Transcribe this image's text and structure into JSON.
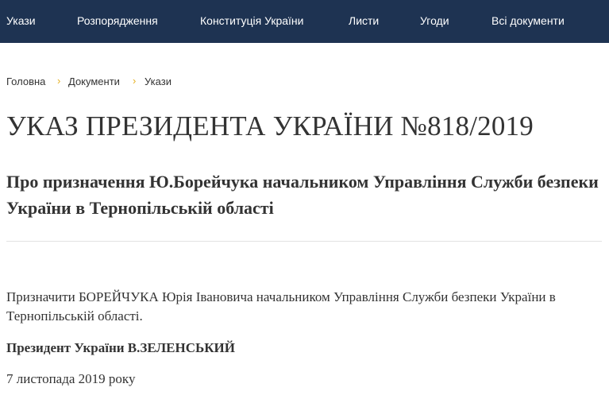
{
  "nav": {
    "items": [
      {
        "label": "Укази"
      },
      {
        "label": "Розпорядження"
      },
      {
        "label": "Конституція України"
      },
      {
        "label": "Листи"
      },
      {
        "label": "Угоди"
      },
      {
        "label": "Всі документи"
      }
    ]
  },
  "breadcrumb": {
    "items": [
      "Головна",
      "Документи",
      "Укази"
    ],
    "separator": "›"
  },
  "document": {
    "title": "УКАЗ ПРЕЗИДЕНТА УКРАЇНИ №818/2019",
    "subtitle": "Про призначення Ю.Борейчука начальником Управління Служби безпеки України в Тернопільській області",
    "body": "Призначити БОРЕЙЧУКА Юрія Івановича начальником Управління Служби безпеки України в Тернопільській області.",
    "signature": "Президент України В.ЗЕЛЕНСЬКИЙ",
    "date": "7 листопада 2019 року"
  },
  "colors": {
    "nav_background": "#1e3352",
    "nav_text": "#ffffff",
    "breadcrumb_separator": "#e6b020",
    "text": "#333333",
    "divider": "#e2e2e2"
  }
}
